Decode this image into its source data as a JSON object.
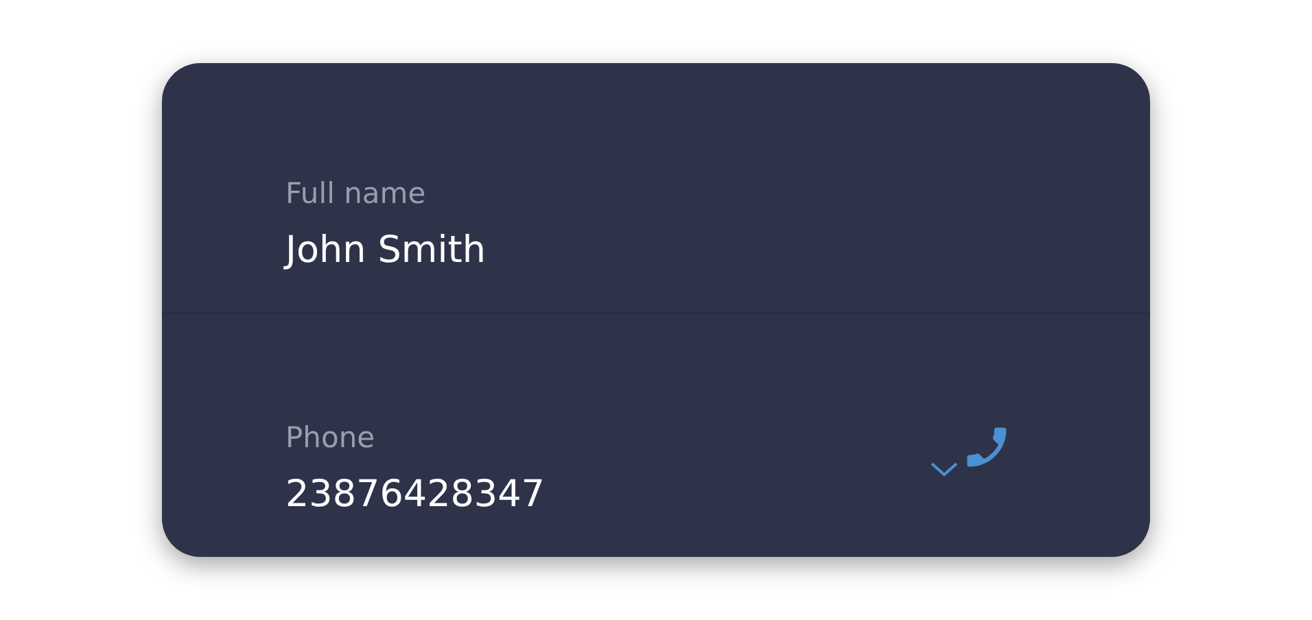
{
  "fields": [
    {
      "kind": "text",
      "label": "Full name",
      "value": "John Smith"
    },
    {
      "kind": "phone",
      "label": "Phone",
      "value": "23876428347"
    }
  ]
}
